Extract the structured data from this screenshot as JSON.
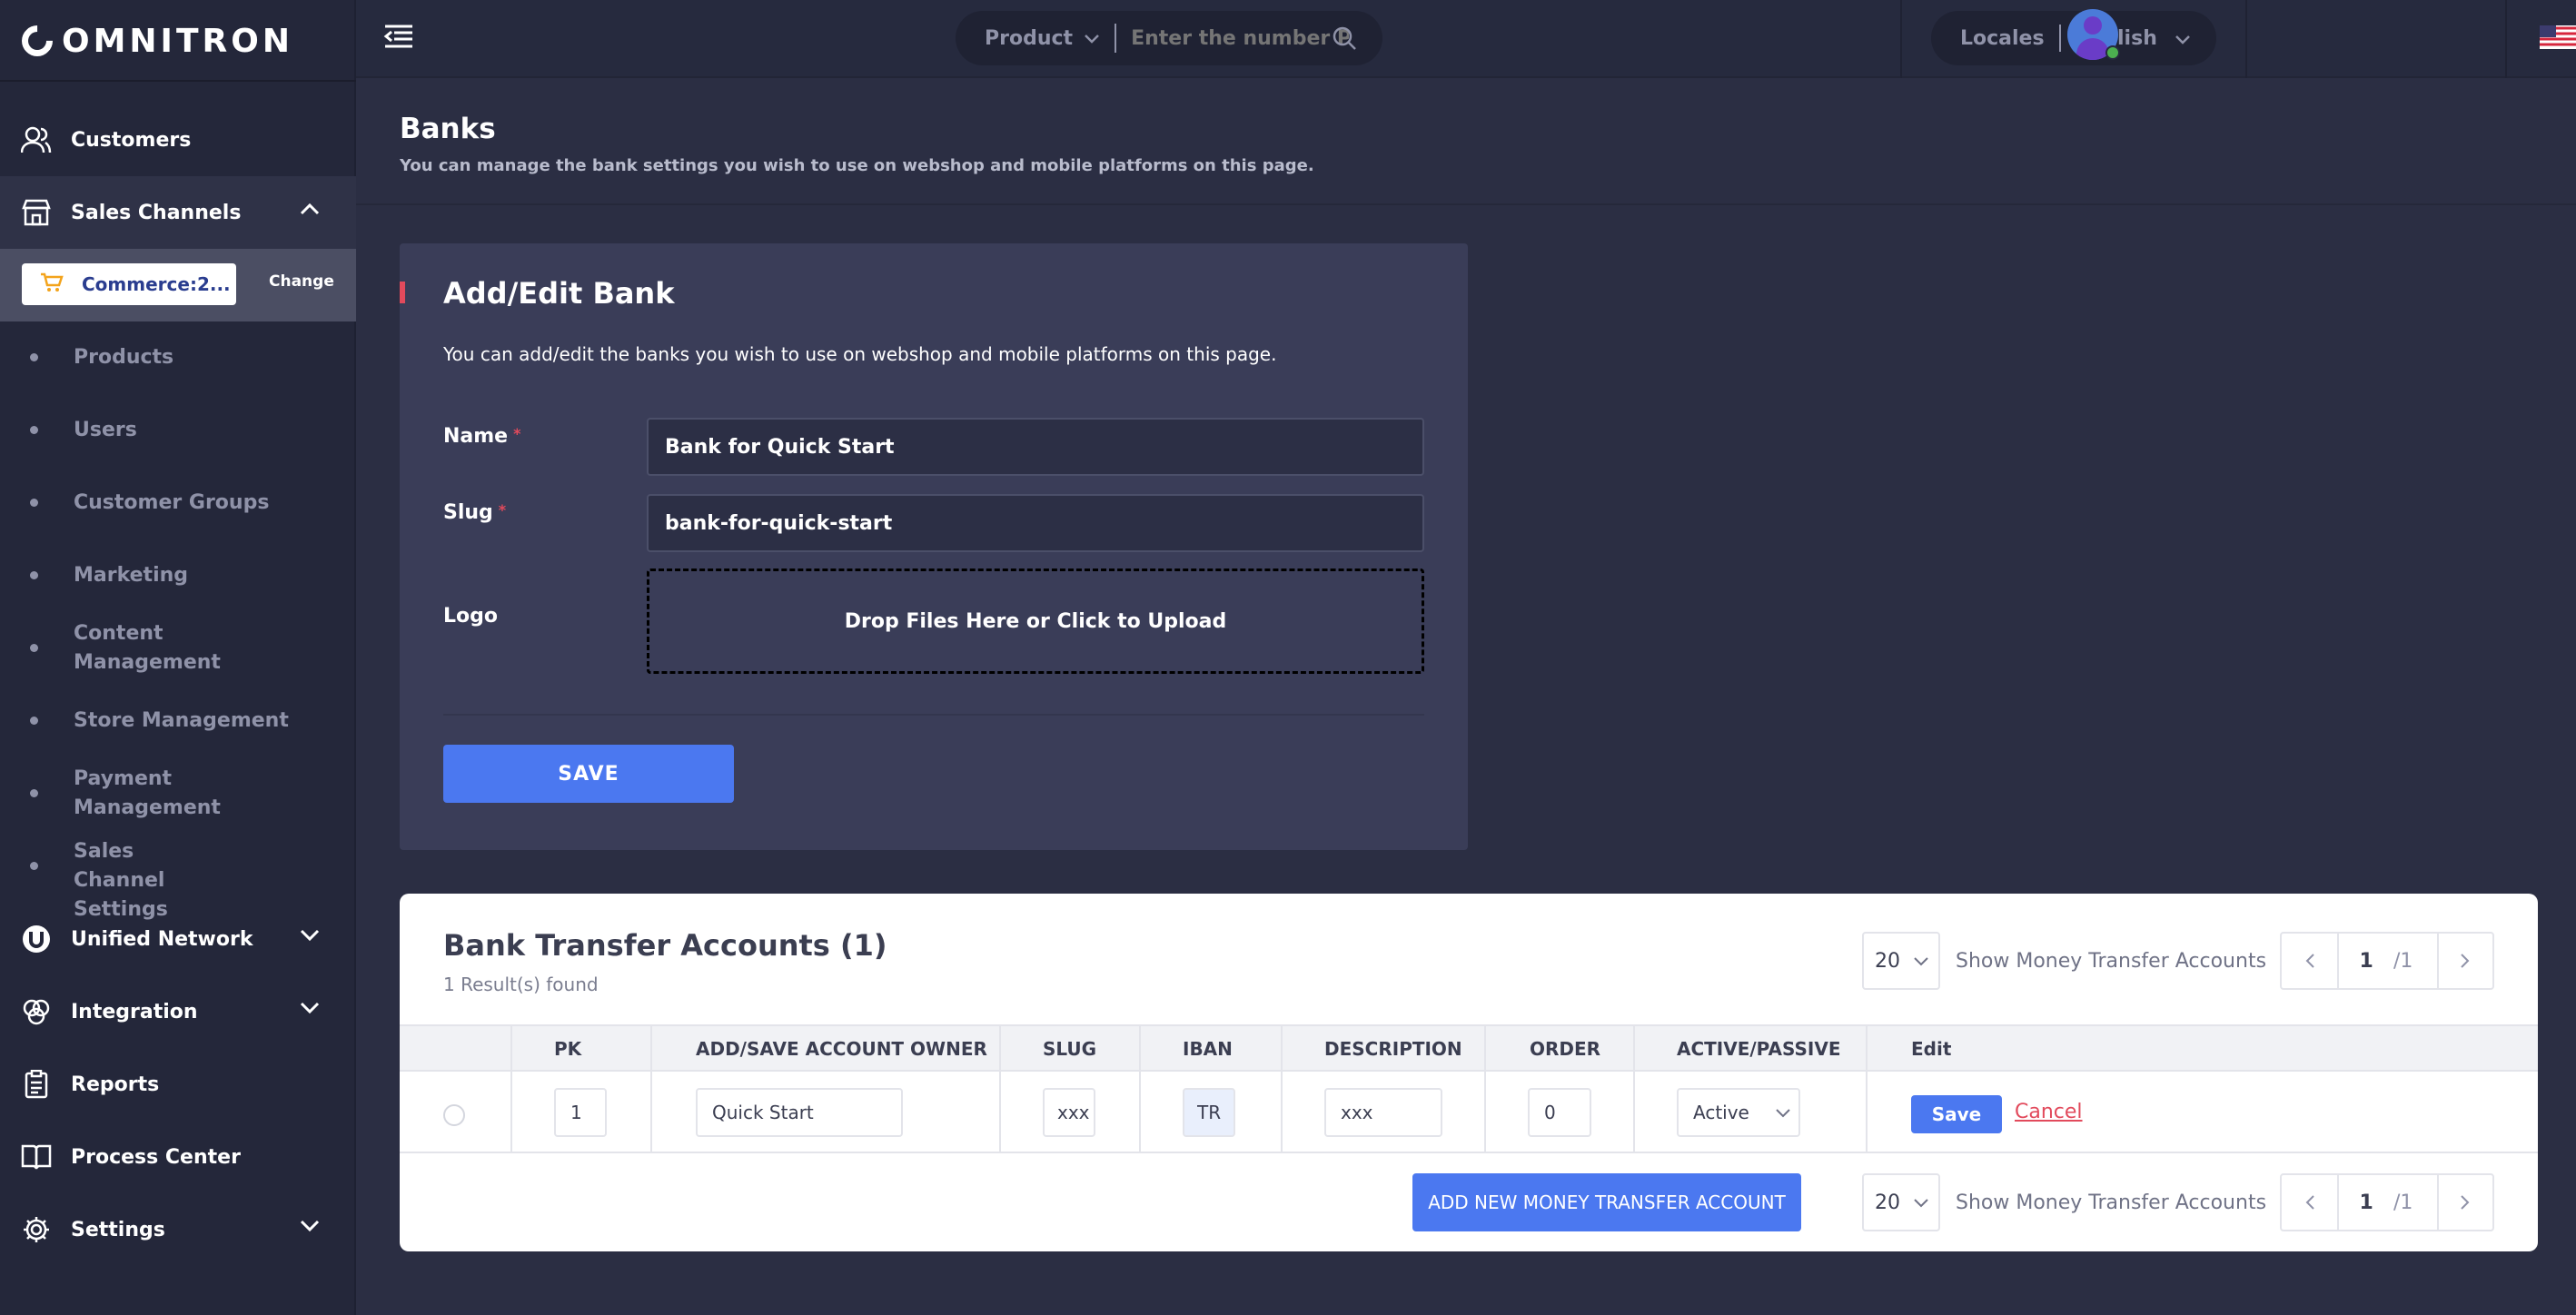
{
  "app": {
    "brand": "OMNITRON"
  },
  "sidebar": {
    "customers": "Customers",
    "sales_channels": "Sales Channels",
    "channel": {
      "name": "Commerce:2...",
      "change": "Change"
    },
    "sub_items": [
      "Products",
      "Users",
      "Customer Groups",
      "Marketing",
      "Content Management",
      "Store Management",
      "Payment Management",
      "Sales Channel Settings"
    ],
    "unified_network": "Unified Network",
    "integration": "Integration",
    "reports": "Reports",
    "process_center": "Process Center",
    "settings": "Settings"
  },
  "topbar": {
    "search_type": "Product",
    "search_placeholder": "Enter the number P...",
    "locales_label": "Locales",
    "locale_value": "English"
  },
  "page": {
    "title": "Banks",
    "subtitle": "You can manage the bank settings you wish to use on webshop and mobile platforms on this page."
  },
  "edit_card": {
    "title": "Add/Edit Bank",
    "description": "You can add/edit the banks you wish to use on webshop and mobile platforms on this page.",
    "name_label": "Name",
    "name_value": "Bank for Quick Start",
    "slug_label": "Slug",
    "slug_value": "bank-for-quick-start",
    "logo_label": "Logo",
    "dropzone": "Drop Files Here or Click to Upload",
    "save": "SAVE",
    "required_mark": "*"
  },
  "accounts": {
    "title": "Bank Transfer Accounts (1)",
    "results": "1 Result(s) found",
    "per_page": "20",
    "per_page_label": "Show Money Transfer Accounts",
    "page": "1",
    "total_pages": "/1",
    "columns": [
      "PK",
      "ADD/SAVE ACCOUNT OWNER",
      "SLUG",
      "IBAN",
      "DESCRIPTION",
      "ORDER",
      "ACTIVE/PASSIVE",
      "Edit"
    ],
    "row": {
      "pk": "1",
      "owner": "Quick Start",
      "slug": "xxx",
      "iban": "TR",
      "description": "xxx",
      "order": "0",
      "status": "Active"
    },
    "row_save": "Save",
    "row_cancel": "Cancel",
    "add_button": "ADD NEW MONEY TRANSFER ACCOUNT"
  },
  "colors": {
    "accent": "#4b78f0",
    "danger": "#e24a5c",
    "sidebar_bg": "#24273a",
    "page_bg": "#2b2e43"
  }
}
